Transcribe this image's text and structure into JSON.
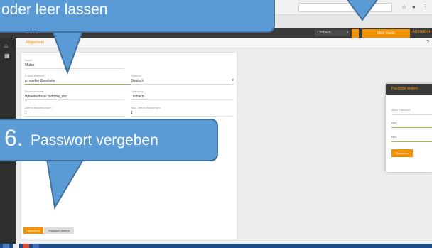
{
  "callouts": {
    "top": {
      "text": "oder leer lassen"
    },
    "bottom": {
      "number": "6.",
      "text": "Passwort vergeben"
    }
  },
  "browser": {
    "icons": [
      "star-icon",
      "user-icon",
      "menu-icon"
    ]
  },
  "app": {
    "brand": "Tenda",
    "location_select": "Lindlach",
    "nav_button": "Mein Konto",
    "link": "Abmelden"
  },
  "tabs": {
    "active": "Allgemein",
    "help": "?"
  },
  "form": {
    "name_label": "Name",
    "name_value": "Müller",
    "email_label": "E-Mail-Adresse",
    "email_value": "p.mueller@website",
    "language_label": "Sprache",
    "language_value": "Deutsch",
    "username_label": "Benutzername",
    "username_value": "Wheeler/Insel Simone_doc",
    "position_label": "Abteilung",
    "position_value": "Lindlach",
    "open_label": "Offene Bewerbungen",
    "open_value": "1",
    "max_label": "Max. offene Buchungen",
    "max_value": "1"
  },
  "buttons": {
    "save": "Speichern",
    "password": "Passwort ändern"
  },
  "modal": {
    "title": "Passwort ändern",
    "old_pw": "Altes Passwort",
    "new_pw": "•••••",
    "repeat_pw": "•••••",
    "save": "Speichern"
  },
  "colors": {
    "accent": "#f39200",
    "callout": "#5b9bd5",
    "dark": "#3a3a3a"
  }
}
